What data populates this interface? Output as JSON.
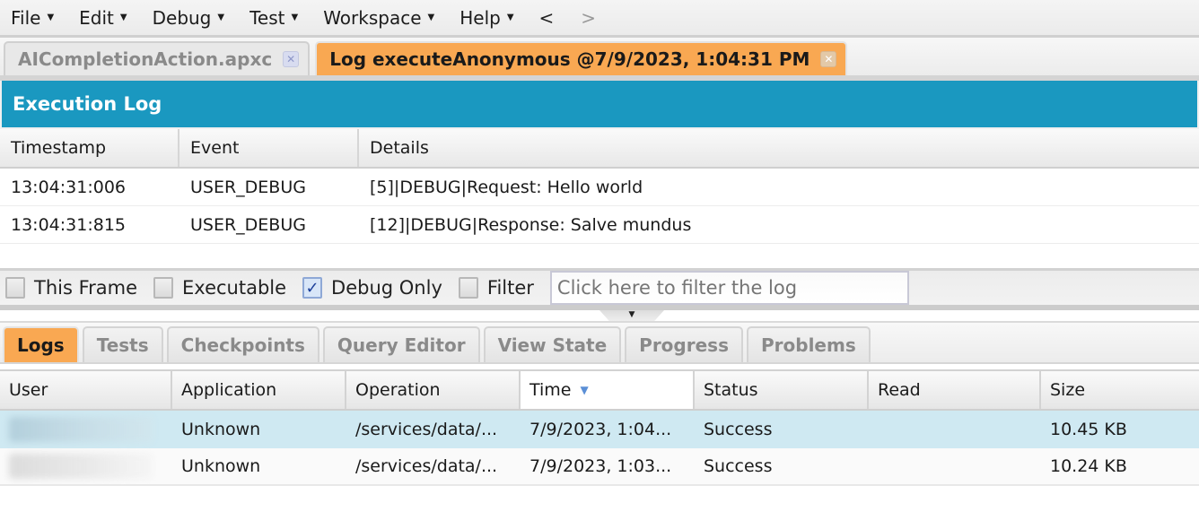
{
  "menubar": {
    "items": [
      {
        "label": "File"
      },
      {
        "label": "Edit"
      },
      {
        "label": "Debug"
      },
      {
        "label": "Test"
      },
      {
        "label": "Workspace"
      },
      {
        "label": "Help"
      }
    ],
    "back_label": "<",
    "forward_label": ">"
  },
  "editor_tabs": [
    {
      "label": "AICompletionAction.apxc",
      "active": false,
      "close_icon": "close-icon"
    },
    {
      "label": "Log executeAnonymous @7/9/2023, 1:04:31 PM",
      "active": true,
      "close_icon": "close-icon"
    }
  ],
  "execution_log": {
    "title": "Execution Log",
    "columns": [
      "Timestamp",
      "Event",
      "Details"
    ],
    "rows": [
      {
        "timestamp": "13:04:31:006",
        "event": "USER_DEBUG",
        "details": "[5]|DEBUG|Request: Hello world"
      },
      {
        "timestamp": "13:04:31:815",
        "event": "USER_DEBUG",
        "details": "[12]|DEBUG|Response: Salve mundus"
      }
    ]
  },
  "filters": {
    "this_frame": {
      "label": "This Frame",
      "checked": false
    },
    "executable": {
      "label": "Executable",
      "checked": false
    },
    "debug_only": {
      "label": "Debug Only",
      "checked": true
    },
    "filter": {
      "label": "Filter",
      "checked": false
    },
    "filter_input": {
      "value": "",
      "placeholder": "Click here to filter the log"
    },
    "check_glyph": "✓"
  },
  "bottom_tabs": [
    {
      "label": "Logs",
      "active": true
    },
    {
      "label": "Tests",
      "active": false
    },
    {
      "label": "Checkpoints",
      "active": false
    },
    {
      "label": "Query Editor",
      "active": false
    },
    {
      "label": "View State",
      "active": false
    },
    {
      "label": "Progress",
      "active": false
    },
    {
      "label": "Problems",
      "active": false
    }
  ],
  "logs_table": {
    "columns": [
      "User",
      "Application",
      "Operation",
      "Time",
      "Status",
      "Read",
      "Size"
    ],
    "sorted_column": "Time",
    "sort_direction": "descending",
    "rows": [
      {
        "user": "[redacted]",
        "application": "Unknown",
        "operation": "/services/data/...",
        "time": "7/9/2023, 1:04...",
        "status": "Success",
        "read": "",
        "size": "10.45 KB",
        "selected": true
      },
      {
        "user": "[redacted]",
        "application": "Unknown",
        "operation": "/services/data/...",
        "time": "7/9/2023, 1:03...",
        "status": "Success",
        "read": "",
        "size": "10.24 KB",
        "selected": false
      }
    ]
  },
  "colors": {
    "accent_orange": "#f9a852",
    "header_blue": "#1a98c0",
    "selected_row": "#cfe9f2",
    "sort_arrow": "#5b8fd6"
  }
}
